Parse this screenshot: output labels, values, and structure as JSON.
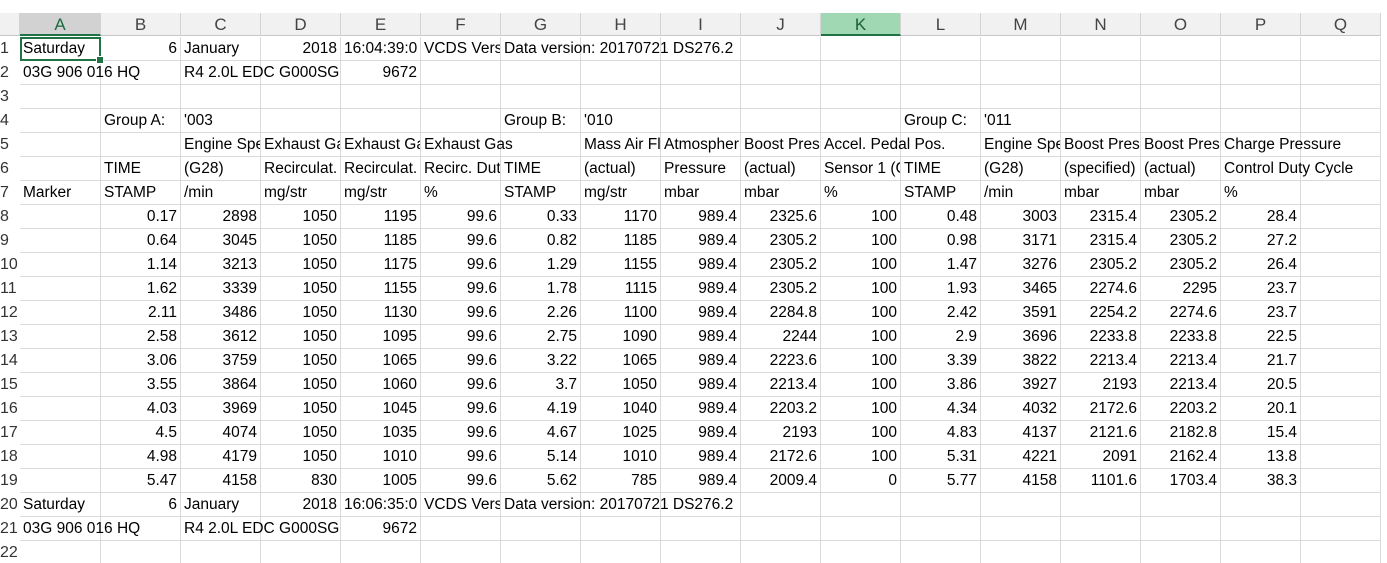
{
  "columns": [
    "A",
    "B",
    "C",
    "D",
    "E",
    "F",
    "G",
    "H",
    "I",
    "J",
    "K",
    "L",
    "M",
    "N",
    "O",
    "P",
    "Q"
  ],
  "selected_column": "A",
  "highlighted_column": "K",
  "active_cell": "A1",
  "accent_color": "#217346",
  "rows": [
    {
      "n": "1",
      "cells": {
        "A": "Saturday",
        "B": "6",
        "C": "January",
        "D": "2018",
        "E": "16:04:39:0",
        "F": "VCDS Vers",
        "G": "Data version: 20170721 DS276.2"
      }
    },
    {
      "n": "2",
      "cells": {
        "A": "03G 906 016 HQ",
        "C": "R4 2.0L EDC G000SG",
        "E": "9672"
      }
    },
    {
      "n": "3",
      "cells": {}
    },
    {
      "n": "4",
      "cells": {
        "B": "Group A:",
        "C": "'003",
        "G": "Group B:",
        "H": "'010",
        "L": "Group C:",
        "M": "'011"
      }
    },
    {
      "n": "5",
      "cells": {
        "C": "Engine Spe",
        "D": "Exhaust Ga",
        "E": "Exhaust Ga",
        "F": "Exhaust Gas",
        "H": "Mass Air Fl",
        "I": "Atmospher",
        "J": "Boost Pres",
        "K": "Accel. Pedal Pos.",
        "M": "Engine Spe",
        "N": "Boost Pres",
        "O": "Boost Pres",
        "P": "Charge Pressure"
      }
    },
    {
      "n": "6",
      "cells": {
        "B": "TIME",
        "C": "(G28)",
        "D": "Recirculat.",
        "E": "Recirculat.",
        "F": "Recirc. Dut",
        "G": "TIME",
        "H": "(actual)",
        "I": "Pressure",
        "J": "(actual)",
        "K": "Sensor 1 (G",
        "L": "TIME",
        "M": "(G28)",
        "N": "(specified)",
        "O": "(actual)",
        "P": "Control Duty Cycle"
      }
    },
    {
      "n": "7",
      "cells": {
        "A": "Marker",
        "B": "STAMP",
        "C": "/min",
        "D": "mg/str",
        "E": "mg/str",
        "F": "%",
        "G": "STAMP",
        "H": "mg/str",
        "I": "mbar",
        "J": "mbar",
        "K": "%",
        "L": "STAMP",
        "M": "/min",
        "N": "mbar",
        "O": "mbar",
        "P": "%"
      }
    },
    {
      "n": "8",
      "cells": {
        "B": "0.17",
        "C": "2898",
        "D": "1050",
        "E": "1195",
        "F": "99.6",
        "G": "0.33",
        "H": "1170",
        "I": "989.4",
        "J": "2325.6",
        "K": "100",
        "L": "0.48",
        "M": "3003",
        "N": "2315.4",
        "O": "2305.2",
        "P": "28.4"
      }
    },
    {
      "n": "9",
      "cells": {
        "B": "0.64",
        "C": "3045",
        "D": "1050",
        "E": "1185",
        "F": "99.6",
        "G": "0.82",
        "H": "1185",
        "I": "989.4",
        "J": "2305.2",
        "K": "100",
        "L": "0.98",
        "M": "3171",
        "N": "2315.4",
        "O": "2305.2",
        "P": "27.2"
      }
    },
    {
      "n": "10",
      "cells": {
        "B": "1.14",
        "C": "3213",
        "D": "1050",
        "E": "1175",
        "F": "99.6",
        "G": "1.29",
        "H": "1155",
        "I": "989.4",
        "J": "2305.2",
        "K": "100",
        "L": "1.47",
        "M": "3276",
        "N": "2305.2",
        "O": "2305.2",
        "P": "26.4"
      }
    },
    {
      "n": "11",
      "cells": {
        "B": "1.62",
        "C": "3339",
        "D": "1050",
        "E": "1155",
        "F": "99.6",
        "G": "1.78",
        "H": "1115",
        "I": "989.4",
        "J": "2305.2",
        "K": "100",
        "L": "1.93",
        "M": "3465",
        "N": "2274.6",
        "O": "2295",
        "P": "23.7"
      }
    },
    {
      "n": "12",
      "cells": {
        "B": "2.11",
        "C": "3486",
        "D": "1050",
        "E": "1130",
        "F": "99.6",
        "G": "2.26",
        "H": "1100",
        "I": "989.4",
        "J": "2284.8",
        "K": "100",
        "L": "2.42",
        "M": "3591",
        "N": "2254.2",
        "O": "2274.6",
        "P": "23.7"
      }
    },
    {
      "n": "13",
      "cells": {
        "B": "2.58",
        "C": "3612",
        "D": "1050",
        "E": "1095",
        "F": "99.6",
        "G": "2.75",
        "H": "1090",
        "I": "989.4",
        "J": "2244",
        "K": "100",
        "L": "2.9",
        "M": "3696",
        "N": "2233.8",
        "O": "2233.8",
        "P": "22.5"
      }
    },
    {
      "n": "14",
      "cells": {
        "B": "3.06",
        "C": "3759",
        "D": "1050",
        "E": "1065",
        "F": "99.6",
        "G": "3.22",
        "H": "1065",
        "I": "989.4",
        "J": "2223.6",
        "K": "100",
        "L": "3.39",
        "M": "3822",
        "N": "2213.4",
        "O": "2213.4",
        "P": "21.7"
      }
    },
    {
      "n": "15",
      "cells": {
        "B": "3.55",
        "C": "3864",
        "D": "1050",
        "E": "1060",
        "F": "99.6",
        "G": "3.7",
        "H": "1050",
        "I": "989.4",
        "J": "2213.4",
        "K": "100",
        "L": "3.86",
        "M": "3927",
        "N": "2193",
        "O": "2213.4",
        "P": "20.5"
      }
    },
    {
      "n": "16",
      "cells": {
        "B": "4.03",
        "C": "3969",
        "D": "1050",
        "E": "1045",
        "F": "99.6",
        "G": "4.19",
        "H": "1040",
        "I": "989.4",
        "J": "2203.2",
        "K": "100",
        "L": "4.34",
        "M": "4032",
        "N": "2172.6",
        "O": "2203.2",
        "P": "20.1"
      }
    },
    {
      "n": "17",
      "cells": {
        "B": "4.5",
        "C": "4074",
        "D": "1050",
        "E": "1035",
        "F": "99.6",
        "G": "4.67",
        "H": "1025",
        "I": "989.4",
        "J": "2193",
        "K": "100",
        "L": "4.83",
        "M": "4137",
        "N": "2121.6",
        "O": "2182.8",
        "P": "15.4"
      }
    },
    {
      "n": "18",
      "cells": {
        "B": "4.98",
        "C": "4179",
        "D": "1050",
        "E": "1010",
        "F": "99.6",
        "G": "5.14",
        "H": "1010",
        "I": "989.4",
        "J": "2172.6",
        "K": "100",
        "L": "5.31",
        "M": "4221",
        "N": "2091",
        "O": "2162.4",
        "P": "13.8"
      }
    },
    {
      "n": "19",
      "cells": {
        "B": "5.47",
        "C": "4158",
        "D": "830",
        "E": "1005",
        "F": "99.6",
        "G": "5.62",
        "H": "785",
        "I": "989.4",
        "J": "2009.4",
        "K": "0",
        "L": "5.77",
        "M": "4158",
        "N": "1101.6",
        "O": "1703.4",
        "P": "38.3"
      }
    },
    {
      "n": "20",
      "cells": {
        "A": "Saturday",
        "B": "6",
        "C": "January",
        "D": "2018",
        "E": "16:06:35:0",
        "F": "VCDS Vers",
        "G": "Data version: 20170721 DS276.2"
      }
    },
    {
      "n": "21",
      "cells": {
        "A": "03G 906 016 HQ",
        "C": "R4 2.0L EDC G000SG",
        "E": "9672"
      }
    },
    {
      "n": "22",
      "cells": {}
    }
  ]
}
